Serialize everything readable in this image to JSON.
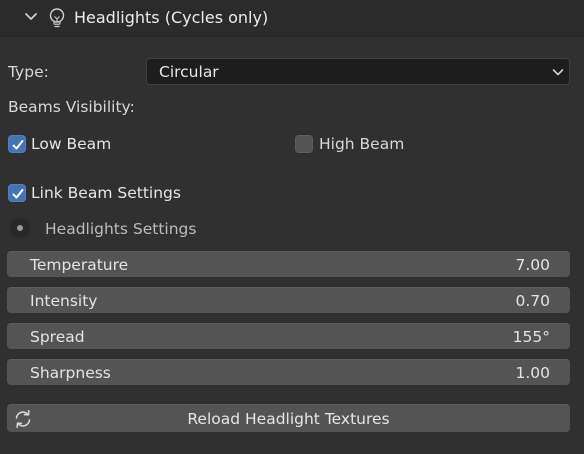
{
  "header": {
    "title": "Headlights (Cycles only)",
    "chevron_icon": "chevron-down-icon",
    "bulb_icon": "light-bulb-icon"
  },
  "type_field": {
    "label": "Type:",
    "value": "Circular"
  },
  "beams": {
    "label": "Beams Visibility:",
    "low_beam": {
      "label": "Low Beam",
      "checked": true
    },
    "high_beam": {
      "label": "High Beam",
      "checked": false
    }
  },
  "link_beam": {
    "label": "Link Beam Settings",
    "checked": true
  },
  "settings_section": {
    "label": "Headlights Settings"
  },
  "sliders": [
    {
      "label": "Temperature",
      "value": "7.00"
    },
    {
      "label": "Intensity",
      "value": "0.70"
    },
    {
      "label": "Spread",
      "value": "155°"
    },
    {
      "label": "Sharpness",
      "value": "1.00"
    }
  ],
  "reload_button": {
    "label": "Reload Headlight Textures",
    "icon": "refresh-icon"
  },
  "colors": {
    "panel_bg": "#303030",
    "header_bg": "#2b2b2b",
    "field_bg": "#545454",
    "dropdown_bg": "#1d1d1d",
    "checkbox_on": "#4772b3"
  }
}
